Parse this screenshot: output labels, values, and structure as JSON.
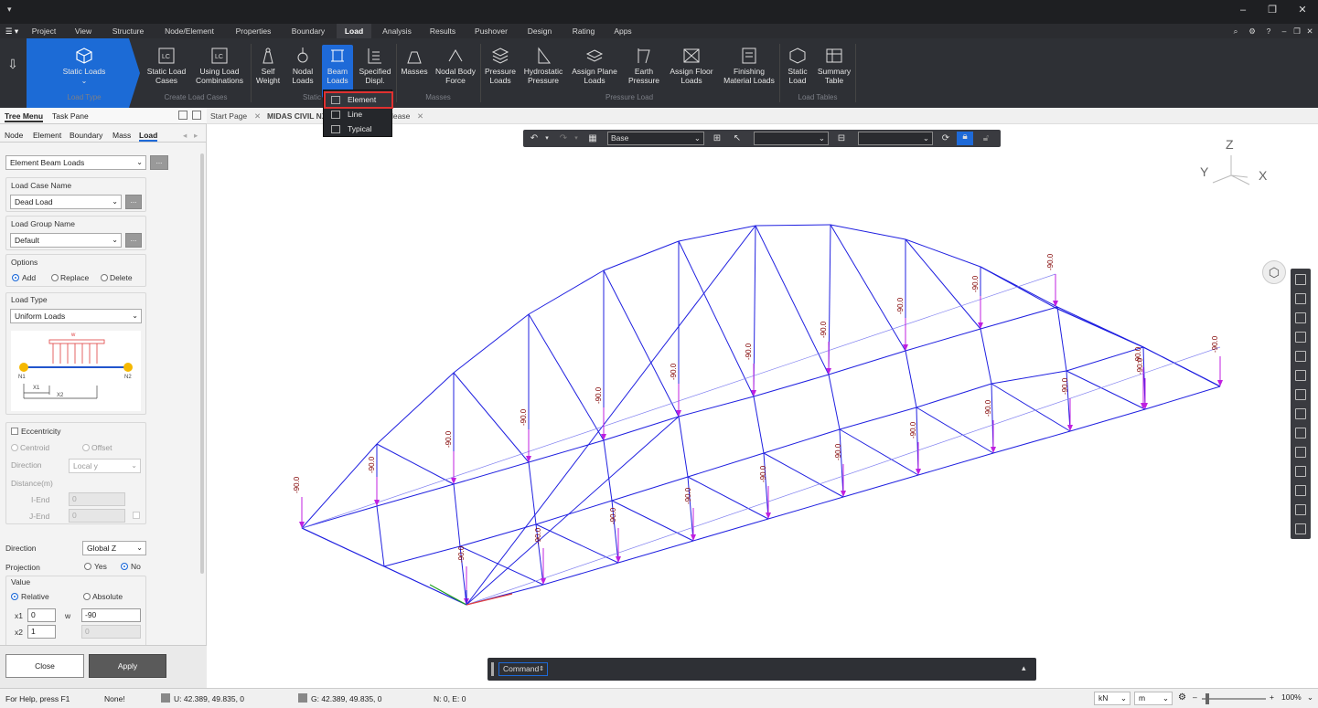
{
  "window": {
    "quick_access": "▾",
    "min_icon": "minimize-icon",
    "max_icon": "restore-icon",
    "close_icon": "close-icon"
  },
  "menu": {
    "tabs": [
      "Project",
      "View",
      "Structure",
      "Node/Element",
      "Properties",
      "Boundary",
      "Load",
      "Analysis",
      "Results",
      "Pushover",
      "Design",
      "Rating",
      "Apps"
    ],
    "active": "Load"
  },
  "ribbon": {
    "buttons": [
      {
        "label": "Static Loads",
        "icon": "cube-icon"
      },
      {
        "label": "Static Load Cases",
        "icon": "lc-icon"
      },
      {
        "label": "Using Load Combinations",
        "icon": "lc-combo-icon"
      },
      {
        "label": "Self Weight",
        "icon": "weight-icon"
      },
      {
        "label": "Nodal Loads",
        "icon": "nodal-load-icon"
      },
      {
        "label": "Beam Loads",
        "icon": "beam-load-icon"
      },
      {
        "label": "Specified Displ.",
        "icon": "displ-icon"
      },
      {
        "label": "Masses",
        "icon": "mass-icon"
      },
      {
        "label": "Nodal Body Force",
        "icon": "body-force-icon"
      },
      {
        "label": "Pressure Loads",
        "icon": "pressure-icon"
      },
      {
        "label": "Hydrostatic Pressure",
        "icon": "hydro-icon"
      },
      {
        "label": "Assign Plane Loads",
        "icon": "plane-load-icon"
      },
      {
        "label": "Earth Pressure",
        "icon": "earth-icon"
      },
      {
        "label": "Assign Floor Loads",
        "icon": "floor-load-icon"
      },
      {
        "label": "Finishing Material Loads",
        "icon": "finishing-icon"
      },
      {
        "label": "Static Load",
        "icon": "static-load-icon"
      },
      {
        "label": "Summary Table",
        "icon": "summary-icon"
      }
    ],
    "groups": [
      "Load Type",
      "Create Load Cases",
      "Static",
      "Masses",
      "Pressure Load",
      "Load Tables"
    ]
  },
  "dropdown": {
    "items": [
      "Element",
      "Line",
      "Typical"
    ],
    "highlighted": "Element"
  },
  "left_panel": {
    "tabs": [
      "Tree Menu",
      "Task Pane"
    ],
    "subtabs": [
      "Node",
      "Element",
      "Boundary",
      "Mass",
      "Load"
    ],
    "active_subtab": "Load",
    "function": "Element Beam Loads",
    "load_case_label": "Load Case Name",
    "load_case": "Dead Load",
    "load_group_label": "Load Group Name",
    "load_group": "Default",
    "options_label": "Options",
    "options": [
      "Add",
      "Replace",
      "Delete"
    ],
    "option_selected": "Add",
    "load_type_label": "Load Type",
    "load_type": "Uniform Loads",
    "diagram": {
      "w": "w",
      "n1": "N1",
      "n2": "N2",
      "x1": "X1",
      "x2": "X2"
    },
    "eccentricity_label": "Eccentricity",
    "ecc_options": [
      "Centroid",
      "Offset"
    ],
    "direction_label": "Direction",
    "ecc_direction": "Local y",
    "distance_label": "Distance(m)",
    "iend_label": "I-End",
    "iend": "0",
    "jend_label": "J-End",
    "jend": "0",
    "load_direction_label": "Direction",
    "load_direction": "Global Z",
    "projection_label": "Projection",
    "projection_options": [
      "Yes",
      "No"
    ],
    "projection_selected": "No",
    "value_label": "Value",
    "value_options": [
      "Relative",
      "Absolute"
    ],
    "value_selected": "Relative",
    "x1_label": "x1",
    "x1": "0",
    "w_label": "w",
    "w": "-90",
    "x2_label": "x2",
    "x2": "1",
    "x2_disabled": "0",
    "close": "Close",
    "apply": "Apply"
  },
  "doc_tabs": [
    "Start Page",
    "MIDAS CIVIL NX",
    "lease"
  ],
  "view_toolbar": {
    "base": "Base"
  },
  "axes": {
    "z": "Z",
    "y": "Y",
    "x": "X"
  },
  "load_value_label": "-90.0",
  "command": "Command",
  "status": {
    "help": "For Help, press F1",
    "none": "None!",
    "u": "U: 42.389, 49.835, 0",
    "g": "G: 42.389, 49.835, 0",
    "ne": "N: 0, E: 0",
    "force_unit": "kN",
    "length_unit": "m",
    "zoom": "100%"
  },
  "colors": {
    "ribbon": "#2e3035",
    "accent": "#1c6bd6",
    "structure": "#2020e0",
    "load_arrow": "#c020e0",
    "load_text": "#800000"
  }
}
